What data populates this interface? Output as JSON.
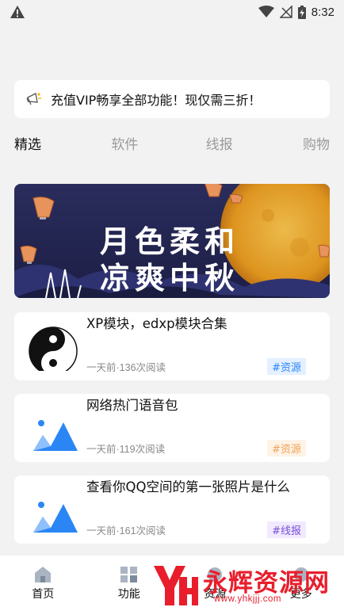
{
  "status_bar": {
    "time": "8:32",
    "warning_icon": "warning-icon",
    "wifi_icon": "wifi-icon",
    "battery_icon": "battery-charging-icon"
  },
  "notice": {
    "icon": "megaphone-icon",
    "text": "充值VIP畅享全部功能！现仅需三折！"
  },
  "tabs": [
    {
      "label": "精选",
      "active": true
    },
    {
      "label": "软件",
      "active": false
    },
    {
      "label": "线报",
      "active": false
    },
    {
      "label": "购物",
      "active": false
    }
  ],
  "banner": {
    "line1": "月色柔和",
    "line2": "凉爽中秋"
  },
  "cards": [
    {
      "title": "XP模块，edxp模块合集",
      "meta": "一天前·136次阅读",
      "tag": "#资源",
      "tag_color": "#2b86f5",
      "thumb_icon": "yin-yang-icon"
    },
    {
      "title": "网络热门语音包",
      "meta": "一天前·119次阅读",
      "tag": "#资源",
      "tag_color": "#f0a35a",
      "thumb_icon": "image-placeholder-icon"
    },
    {
      "title": "查看你QQ空间的第一张照片是什么",
      "meta": "一天前·161次阅读",
      "tag": "#线报",
      "tag_color": "#7a4fd9",
      "thumb_icon": "image-placeholder-icon"
    }
  ],
  "bottom_nav": [
    {
      "label": "首页",
      "icon": "home-icon"
    },
    {
      "label": "功能",
      "icon": "grid-icon"
    },
    {
      "label": "资源",
      "icon": "resource-icon"
    },
    {
      "label": "更多",
      "icon": "more-icon"
    }
  ],
  "watermark": {
    "text": "永辉资源网",
    "url": "www.yhkjjj.com"
  }
}
